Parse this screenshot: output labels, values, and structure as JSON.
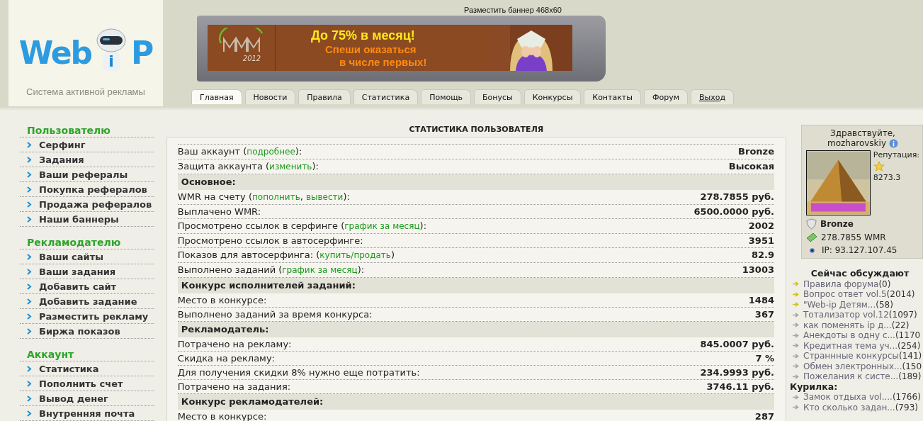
{
  "logo": {
    "word": "Web",
    "robot_letter": "i",
    "letter": "P",
    "tagline": "Система активной рекламы"
  },
  "banner": {
    "place_link": "Разместить баннер 468x60",
    "year": "2012",
    "headline": "До 75% в месяц!",
    "lines": [
      "Спеши оказаться",
      "в числе первых!"
    ]
  },
  "tabs": [
    {
      "label": "Главная",
      "kind": "tab",
      "selected": true
    },
    {
      "label": "Новости",
      "kind": "tab",
      "selected": false
    },
    {
      "label": "Правила",
      "kind": "tab",
      "selected": false
    },
    {
      "label": "Статистика",
      "kind": "tab",
      "selected": false
    },
    {
      "label": "Помощь",
      "kind": "tab",
      "selected": false
    },
    {
      "label": "Бонусы",
      "kind": "tab",
      "selected": false
    },
    {
      "label": "Конкурсы",
      "kind": "tab",
      "selected": false
    },
    {
      "label": "Контакты",
      "kind": "tab",
      "selected": false
    },
    {
      "label": "Форум",
      "kind": "tab",
      "selected": false
    },
    {
      "label": "Выход",
      "kind": "link",
      "selected": false
    }
  ],
  "sidebar": [
    {
      "title": "Пользователю",
      "items": [
        "Серфинг",
        "Задания",
        "Ваши рефералы",
        "Покупка рефералов",
        "Продажа рефералов",
        "Наши баннеры"
      ]
    },
    {
      "title": "Рекламодателю",
      "items": [
        "Ваши сайты",
        "Ваши задания",
        "Добавить сайт",
        "Добавить задание",
        "Разместить рекламу",
        "Биржа показов"
      ]
    },
    {
      "title": "Аккаунт",
      "items": [
        "Статистика",
        "Пополнить счет",
        "Вывод денег",
        "Внутренняя почта"
      ]
    }
  ],
  "stats": {
    "title": "СТАТИСТИКА ПОЛЬЗОВАТЕЛЯ",
    "rows": [
      {
        "kind": "row",
        "parts": [
          {
            "kind": "text",
            "text": "Ваш аккаунт ("
          },
          {
            "kind": "link",
            "text": "подробнее"
          },
          {
            "kind": "text",
            "text": "):"
          }
        ],
        "value": "Bronze"
      },
      {
        "kind": "row",
        "parts": [
          {
            "kind": "text",
            "text": "Защита аккаунта ("
          },
          {
            "kind": "link",
            "text": "изменить"
          },
          {
            "kind": "text",
            "text": "):"
          }
        ],
        "value": "Высокая"
      },
      {
        "kind": "section",
        "title": "Основное:"
      },
      {
        "kind": "row",
        "parts": [
          {
            "kind": "text",
            "text": "WMR на счету ("
          },
          {
            "kind": "link",
            "text": "пополнить"
          },
          {
            "kind": "text",
            "text": ", "
          },
          {
            "kind": "link",
            "text": "вывести"
          },
          {
            "kind": "text",
            "text": "):"
          }
        ],
        "value": "278.7855 руб."
      },
      {
        "kind": "row",
        "parts": [
          {
            "kind": "text",
            "text": "Выплачено WMR:"
          }
        ],
        "value": "6500.0000 руб."
      },
      {
        "kind": "row",
        "parts": [
          {
            "kind": "text",
            "text": "Просмотрено ссылок в серфинге ("
          },
          {
            "kind": "link",
            "text": "график за месяц"
          },
          {
            "kind": "text",
            "text": "):"
          }
        ],
        "value": "2002"
      },
      {
        "kind": "row",
        "parts": [
          {
            "kind": "text",
            "text": "Просмотрено ссылок в автосерфинге:"
          }
        ],
        "value": "3951"
      },
      {
        "kind": "row",
        "parts": [
          {
            "kind": "text",
            "text": "Показов для автосерфинга: ("
          },
          {
            "kind": "link",
            "text": "купить/продать"
          },
          {
            "kind": "text",
            "text": ")"
          }
        ],
        "value": "82.9"
      },
      {
        "kind": "row",
        "parts": [
          {
            "kind": "text",
            "text": "Выполнено заданий ("
          },
          {
            "kind": "link",
            "text": "график за месяц"
          },
          {
            "kind": "text",
            "text": "):"
          }
        ],
        "value": "13003"
      },
      {
        "kind": "section",
        "title": "Конкурс исполнителей заданий:"
      },
      {
        "kind": "row",
        "parts": [
          {
            "kind": "text",
            "text": "Место в конкурсе:"
          }
        ],
        "value": "1484"
      },
      {
        "kind": "row",
        "parts": [
          {
            "kind": "text",
            "text": "Выполнено заданий за время конкурса:"
          }
        ],
        "value": "367"
      },
      {
        "kind": "section",
        "title": "Рекламодатель:"
      },
      {
        "kind": "row",
        "parts": [
          {
            "kind": "text",
            "text": "Потрачено на рекламу:"
          }
        ],
        "value": "845.0007 руб."
      },
      {
        "kind": "row",
        "parts": [
          {
            "kind": "text",
            "text": "Скидка на рекламу:"
          }
        ],
        "value": "7 %"
      },
      {
        "kind": "row",
        "parts": [
          {
            "kind": "text",
            "text": "Для получения скидки 8% нужно еще потратить:"
          }
        ],
        "value": "234.9993 руб."
      },
      {
        "kind": "row",
        "parts": [
          {
            "kind": "text",
            "text": "Потрачено на задания:"
          }
        ],
        "value": "3746.11 руб."
      },
      {
        "kind": "section",
        "title": "Конкурс рекламодателей:"
      },
      {
        "kind": "row",
        "parts": [
          {
            "kind": "text",
            "text": "Место в конкурсе:"
          }
        ],
        "value": "287"
      }
    ]
  },
  "profile": {
    "greeting": "Здравствуйте,",
    "username": "mozharovskiy",
    "reputation_label": "Репутация:",
    "reputation": "8273.3",
    "lines": [
      {
        "kind": "status",
        "text": "Bronze"
      },
      {
        "kind": "money",
        "text": "278.7855 WMR"
      },
      {
        "kind": "ip",
        "text": "IP: 93.127.107.45"
      }
    ]
  },
  "forum": [
    {
      "kind": "main",
      "title": "Сейчас обсуждают",
      "items": [
        {
          "title": "Правила форума",
          "count": "(0)",
          "color": "#d4c21a"
        },
        {
          "title": "Вопрос ответ vol.5",
          "count": "(2014)",
          "color": "#d4c21a"
        },
        {
          "title": "\"Web-ip Детям...",
          "count": "(58)",
          "color": "#d4c21a"
        },
        {
          "title": "Тотализатор vol.12",
          "count": "(1097)",
          "color": "#a8a8a0"
        },
        {
          "title": "как поменять ip д...",
          "count": "(22)",
          "color": "#a8a8a0"
        },
        {
          "title": "Анекдоты в одну с...",
          "count": "(1170",
          "color": "#a8a8a0"
        },
        {
          "title": "Кредитная тема уч...",
          "count": "(254)",
          "color": "#a8a8a0"
        },
        {
          "title": "Страннные конкурсы",
          "count": "(141)",
          "color": "#a8a8a0"
        },
        {
          "title": "Обмен электронных...",
          "count": "(150",
          "color": "#a8a8a0"
        },
        {
          "title": "Пожелания к систе...",
          "count": "(189)",
          "color": "#a8a8a0"
        }
      ]
    },
    {
      "kind": "sub",
      "title": "Курилка:",
      "items": [
        {
          "title": "Замок отдыха vol....",
          "count": "(1766)",
          "color": "#a8a8a0"
        },
        {
          "title": "Кто сколько задан...",
          "count": "(793)",
          "color": "#a8a8a0"
        }
      ]
    }
  ]
}
